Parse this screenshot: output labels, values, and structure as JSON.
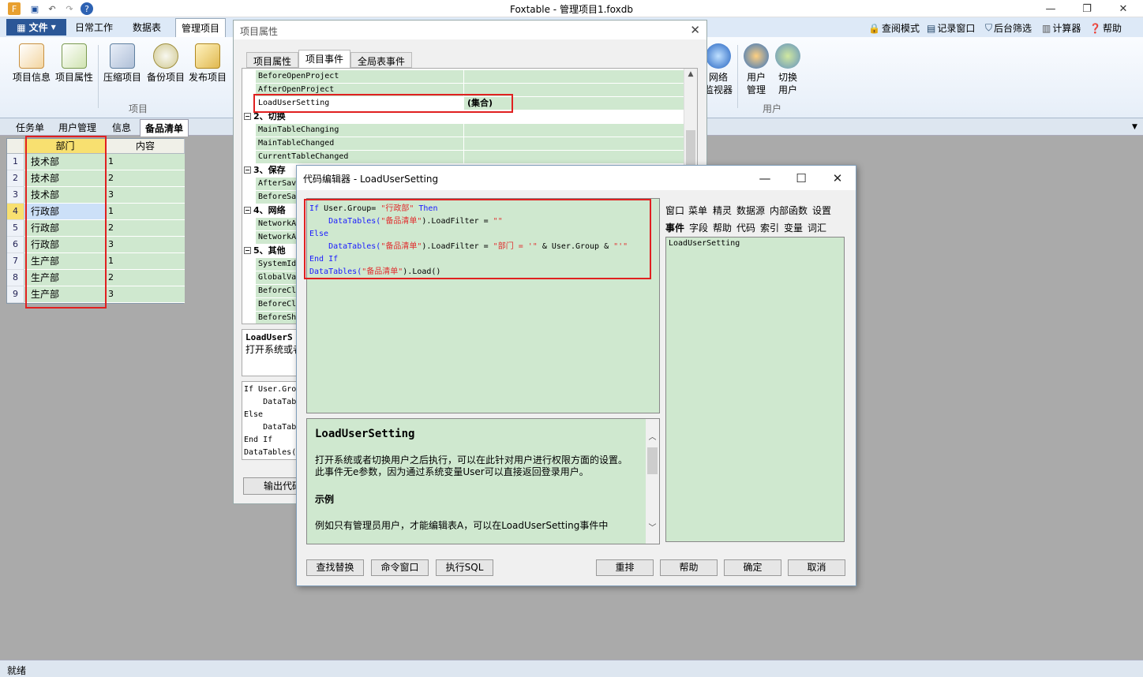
{
  "window": {
    "title": "Foxtable - 管理项目1.foxdb"
  },
  "menu": {
    "file": "文件",
    "tabs": [
      "日常工作",
      "数据表",
      "管理项目"
    ],
    "right": [
      "查阅模式",
      "记录窗口",
      "后台筛选",
      "计算器",
      "帮助"
    ]
  },
  "ribbon": {
    "project_buttons": [
      "项目信息",
      "项目属性",
      "压缩项目",
      "备份项目",
      "发布项目"
    ],
    "project_group": "项目",
    "network_button": [
      "网络",
      "监视器"
    ],
    "user_buttons": [
      [
        "用户",
        "管理"
      ],
      [
        "切换",
        "用户"
      ]
    ],
    "user_group": "用户"
  },
  "doc_tabs": [
    "任务单",
    "用户管理",
    "信息",
    "备品清单"
  ],
  "grid": {
    "headers": [
      "部门",
      "内容"
    ],
    "rows": [
      {
        "n": "1",
        "dept": "技术部",
        "content": "1"
      },
      {
        "n": "2",
        "dept": "技术部",
        "content": "2"
      },
      {
        "n": "3",
        "dept": "技术部",
        "content": "3"
      },
      {
        "n": "4",
        "dept": "行政部",
        "content": "1"
      },
      {
        "n": "5",
        "dept": "行政部",
        "content": "2"
      },
      {
        "n": "6",
        "dept": "行政部",
        "content": "3"
      },
      {
        "n": "7",
        "dept": "生产部",
        "content": "1"
      },
      {
        "n": "8",
        "dept": "生产部",
        "content": "2"
      },
      {
        "n": "9",
        "dept": "生产部",
        "content": "3"
      }
    ]
  },
  "status": "就绪",
  "project_dialog": {
    "title": "项目属性",
    "tabs": [
      "项目属性",
      "项目事件",
      "全局表事件"
    ],
    "events_top": [
      "BeforeOpenProject",
      "AfterOpenProject",
      "LoadUserSetting"
    ],
    "selected_value": "(集合)",
    "cat2": "2、切换",
    "events_switch": [
      "MainTableChanging",
      "MainTableChanged",
      "CurrentTableChanged"
    ],
    "cat3": "3、保存",
    "events_save": [
      "AfterSav",
      "BeforeSa"
    ],
    "cat4": "4、网络",
    "events_net": [
      "NetworkA",
      "NetworkA"
    ],
    "cat5": "5、其他",
    "events_other": [
      "SystemId",
      "GlobalVa",
      "BeforeCl",
      "BeforeCl",
      "BeforeSh"
    ],
    "desc_title": "LoadUserS",
    "desc_text": "打开系统或者",
    "code_lines": [
      "If User.Gro",
      "    DataTab",
      "Else",
      "    DataTab",
      "End If",
      "DataTables("
    ],
    "export_button": "输出代码"
  },
  "code_editor": {
    "title": "代码编辑器 - LoadUserSetting",
    "code": {
      "l1_kw": "If",
      "l1_a": " User.Group= ",
      "l1_s": "\"行政部\"",
      "l1_kw2": " Then",
      "l2_a": "    DataTables(",
      "l2_s": "\"备品清单\"",
      "l2_b": ").LoadFilter = ",
      "l2_s2": "\"\"",
      "l3_kw": "Else",
      "l4_a": "    DataTables(",
      "l4_s": "\"备品清单\"",
      "l4_b": ").LoadFilter = ",
      "l4_s2": "\"部门 = '\"",
      "l4_c": " & User.Group & ",
      "l4_s3": "\"'\"",
      "l5_kw": "End If",
      "l6_a": "DataTables(",
      "l6_s": "\"备品清单\"",
      "l6_b": ").Load()"
    },
    "help": {
      "title": "LoadUserSetting",
      "p1": "打开系统或者切换用户之后执行，可以在此针对用户进行权限方面的设置。",
      "p2": "此事件无e参数，因为通过系统变量User可以直接返回登录用户。",
      "h2": "示例",
      "p3": "例如只有管理员用户，才能编辑表A，可以在LoadUserSetting事件中"
    },
    "right_tabs_row1": [
      "窗口",
      "菜单",
      "精灵",
      "数据源",
      "内部函数",
      "设置"
    ],
    "right_tabs_row2": [
      "事件",
      "字段",
      "帮助",
      "代码",
      "索引",
      "变量",
      "词汇"
    ],
    "right_list": [
      "LoadUserSetting"
    ],
    "buttons": [
      "查找替换",
      "命令窗口",
      "执行SQL",
      "重排",
      "帮助",
      "确定",
      "取消"
    ]
  }
}
